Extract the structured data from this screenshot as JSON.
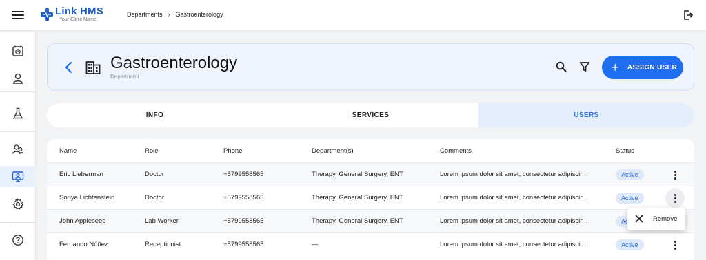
{
  "app": {
    "title": "Link HMS",
    "subtitle": "Your Clinic Name",
    "brand_color": "#1f5fce",
    "accent_color": "#1f6ef0"
  },
  "breadcrumb": {
    "items": [
      "Departments",
      "Gastroenterology"
    ],
    "separator": "›"
  },
  "sidebar": {
    "items": [
      {
        "icon": "calendar-clock-icon",
        "active": false
      },
      {
        "icon": "user-icon",
        "active": false
      },
      {
        "icon": "flask-icon",
        "active": false
      },
      {
        "icon": "users-group-icon",
        "active": false
      },
      {
        "icon": "monitor-user-icon",
        "active": true
      },
      {
        "icon": "gear-icon",
        "active": false
      },
      {
        "icon": "help-icon",
        "active": false
      }
    ]
  },
  "header": {
    "title": "Gastroenterology",
    "subtitle": "Department",
    "assign_label": "ASSIGN USER"
  },
  "tabs": [
    {
      "label": "INFO",
      "active": false
    },
    {
      "label": "SERVICES",
      "active": false
    },
    {
      "label": "USERS",
      "active": true
    }
  ],
  "table": {
    "columns": [
      "Name",
      "Role",
      "Phone",
      "Department(s)",
      "Comments",
      "Status"
    ],
    "rows": [
      {
        "name": "Eric Lieberman",
        "role": "Doctor",
        "phone": "+5799558565",
        "departments": "Therapy, General Surgery, ENT",
        "comments": "Lorem ipsum dolor sit amet, consectetur adipiscing elit",
        "status": "Active"
      },
      {
        "name": "Sonya Lichtenstein",
        "role": "Doctor",
        "phone": "+5799558565",
        "departments": "Therapy, General Surgery, ENT",
        "comments": "Lorem ipsum dolor sit amet, consectetur adipiscing elit",
        "status": "Active"
      },
      {
        "name": "John Appleseed",
        "role": "Lab Worker",
        "phone": "+5799558565",
        "departments": "Therapy, General Surgery, ENT",
        "comments": "Lorem ipsum dolor sit amet, consectetur adipiscing elit",
        "status": "Active"
      },
      {
        "name": "Fernando Núñez",
        "role": "Receptionist",
        "phone": "+5799558565",
        "departments": "—",
        "comments": "Lorem ipsum dolor sit amet, consectetur adipiscing elit",
        "status": "Active"
      }
    ]
  },
  "context_menu": {
    "items": [
      {
        "label": "Remove",
        "icon": "close-icon"
      }
    ]
  }
}
